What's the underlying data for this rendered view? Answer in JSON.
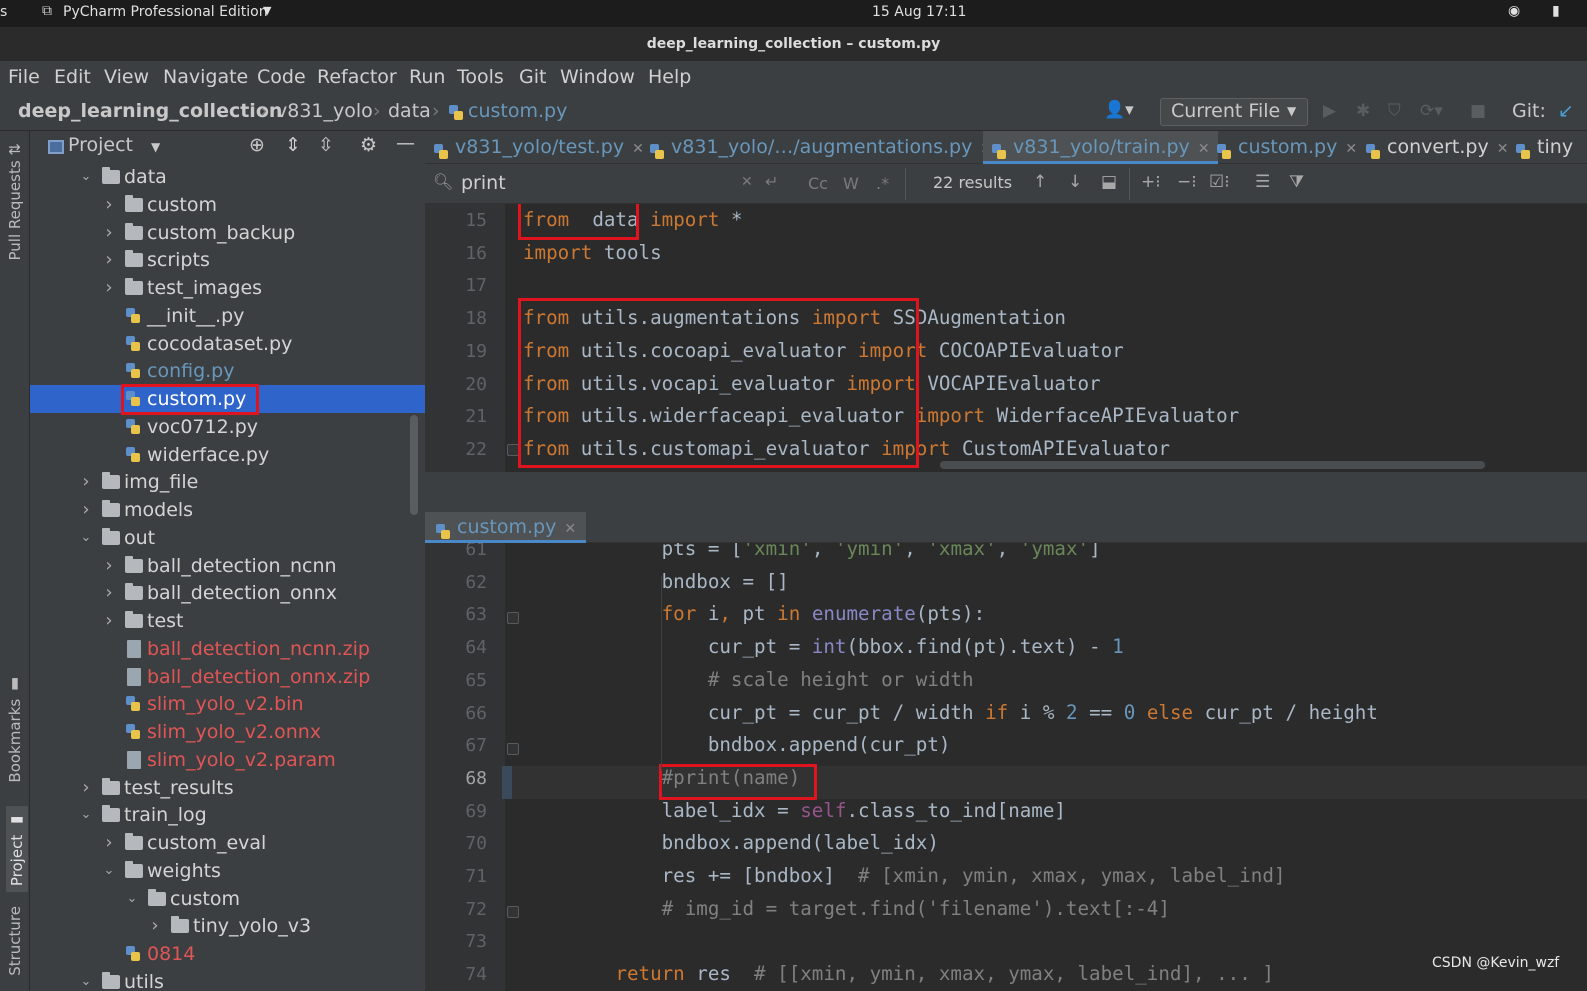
{
  "system_bar": {
    "app_label": "PyCharm Professional Edition",
    "clock": "15 Aug  17:11",
    "left_edge": "s"
  },
  "window_title": "deep_learning_collection – custom.py",
  "menu": [
    "File",
    "Edit",
    "View",
    "Navigate",
    "Code",
    "Refactor",
    "Run",
    "Tools",
    "Git",
    "Window",
    "Help"
  ],
  "breadcrumb": [
    "deep_learning_collection",
    "v831_yolo",
    "data",
    "custom.py"
  ],
  "toolbar": {
    "run_config": "Current File",
    "git_label": "Git:"
  },
  "project_panel": {
    "title": "Project"
  },
  "side_tools": {
    "pull_requests": "Pull Requests",
    "bookmarks": "Bookmarks",
    "project": "Project",
    "structure": "Structure"
  },
  "tree": [
    {
      "label": "data",
      "kind": "folder",
      "depth": 0,
      "expanded": true,
      "color": "normal"
    },
    {
      "label": "custom",
      "kind": "folder",
      "depth": 1,
      "expanded": false,
      "color": "normal"
    },
    {
      "label": "custom_backup",
      "kind": "folder",
      "depth": 1,
      "expanded": false,
      "color": "normal"
    },
    {
      "label": "scripts",
      "kind": "folder",
      "depth": 1,
      "expanded": false,
      "color": "normal"
    },
    {
      "label": "test_images",
      "kind": "folder",
      "depth": 1,
      "expanded": false,
      "color": "normal"
    },
    {
      "label": "__init__.py",
      "kind": "py",
      "depth": 1,
      "color": "normal"
    },
    {
      "label": "cocodataset.py",
      "kind": "py",
      "depth": 1,
      "color": "normal"
    },
    {
      "label": "config.py",
      "kind": "py",
      "depth": 1,
      "color": "blue"
    },
    {
      "label": "custom.py",
      "kind": "py",
      "depth": 1,
      "color": "normal",
      "selected": true
    },
    {
      "label": "voc0712.py",
      "kind": "py",
      "depth": 1,
      "color": "normal"
    },
    {
      "label": "widerface.py",
      "kind": "py",
      "depth": 1,
      "color": "normal"
    },
    {
      "label": "img_file",
      "kind": "folder",
      "depth": 0,
      "expanded": false,
      "color": "normal"
    },
    {
      "label": "models",
      "kind": "folder",
      "depth": 0,
      "expanded": false,
      "color": "normal"
    },
    {
      "label": "out",
      "kind": "folder",
      "depth": 0,
      "expanded": true,
      "color": "normal"
    },
    {
      "label": "ball_detection_ncnn",
      "kind": "folder",
      "depth": 1,
      "expanded": false,
      "color": "normal"
    },
    {
      "label": "ball_detection_onnx",
      "kind": "folder",
      "depth": 1,
      "expanded": false,
      "color": "normal"
    },
    {
      "label": "test",
      "kind": "folder",
      "depth": 1,
      "expanded": false,
      "color": "normal"
    },
    {
      "label": "ball_detection_ncnn.zip",
      "kind": "file",
      "depth": 1,
      "color": "red"
    },
    {
      "label": "ball_detection_onnx.zip",
      "kind": "file",
      "depth": 1,
      "color": "red"
    },
    {
      "label": "slim_yolo_v2.bin",
      "kind": "py",
      "depth": 1,
      "color": "red"
    },
    {
      "label": "slim_yolo_v2.onnx",
      "kind": "py",
      "depth": 1,
      "color": "red"
    },
    {
      "label": "slim_yolo_v2.param",
      "kind": "file",
      "depth": 1,
      "color": "red"
    },
    {
      "label": "test_results",
      "kind": "folder",
      "depth": 0,
      "expanded": false,
      "color": "normal"
    },
    {
      "label": "train_log",
      "kind": "folder",
      "depth": 0,
      "expanded": true,
      "color": "normal"
    },
    {
      "label": "custom_eval",
      "kind": "folder",
      "depth": 1,
      "expanded": false,
      "color": "normal"
    },
    {
      "label": "weights",
      "kind": "folder",
      "depth": 1,
      "expanded": true,
      "color": "normal"
    },
    {
      "label": "custom",
      "kind": "folder",
      "depth": 2,
      "expanded": true,
      "color": "normal"
    },
    {
      "label": "tiny_yolo_v3",
      "kind": "folder",
      "depth": 3,
      "expanded": false,
      "color": "normal"
    },
    {
      "label": "0814",
      "kind": "py",
      "depth": 1,
      "color": "red"
    },
    {
      "label": "utils",
      "kind": "folder",
      "depth": 0,
      "expanded": true,
      "color": "normal"
    }
  ],
  "tabs": [
    {
      "label": "v831_yolo/test.py",
      "closable": true,
      "active": false
    },
    {
      "label": "v831_yolo/…/augmentations.py",
      "closable": true,
      "active": false
    },
    {
      "label": "v831_yolo/train.py",
      "closable": true,
      "active": true
    },
    {
      "label": "custom.py",
      "closable": true,
      "active": false
    },
    {
      "label": "convert.py",
      "closable": true,
      "active": false
    },
    {
      "label": "tiny",
      "closable": false,
      "active": false
    }
  ],
  "search": {
    "query": "print",
    "results": "22 results",
    "opt_case": "Cc",
    "opt_word": "W",
    "opt_regex": ".*"
  },
  "editor_top": {
    "lines": [
      {
        "n": "15",
        "tokens": [
          [
            "kw",
            "from"
          ],
          [
            "",
            "  data "
          ],
          [
            "kw",
            "import"
          ],
          [
            "",
            " *"
          ]
        ]
      },
      {
        "n": "16",
        "tokens": [
          [
            "kw",
            "import"
          ],
          [
            "",
            " tools"
          ]
        ]
      },
      {
        "n": "17",
        "tokens": []
      },
      {
        "n": "18",
        "tokens": [
          [
            "kw",
            "from"
          ],
          [
            "",
            " utils.augmentations "
          ],
          [
            "kw",
            "import"
          ],
          [
            "",
            " SSDAugmentation"
          ]
        ]
      },
      {
        "n": "19",
        "tokens": [
          [
            "kw",
            "from"
          ],
          [
            "",
            " utils.cocoapi_evaluator "
          ],
          [
            "kw",
            "import"
          ],
          [
            "",
            " COCOAPIEvaluator"
          ]
        ]
      },
      {
        "n": "20",
        "tokens": [
          [
            "kw",
            "from"
          ],
          [
            "",
            " utils.vocapi_evaluator "
          ],
          [
            "kw",
            "import"
          ],
          [
            "",
            " VOCAPIEvaluator"
          ]
        ]
      },
      {
        "n": "21",
        "tokens": [
          [
            "kw",
            "from"
          ],
          [
            "",
            " utils.widerfaceapi_evaluator "
          ],
          [
            "kw",
            "import"
          ],
          [
            "",
            " WiderfaceAPIEvaluator"
          ]
        ]
      },
      {
        "n": "22",
        "tokens": [
          [
            "kw",
            "from"
          ],
          [
            "",
            " utils.customapi_evaluator "
          ],
          [
            "kw",
            "import"
          ],
          [
            "",
            " CustomAPIEvaluator"
          ]
        ]
      }
    ]
  },
  "editor_bottom_tab": "custom.py",
  "editor_bottom": {
    "lines": [
      {
        "n": "61",
        "tokens": [
          [
            "",
            "            pts = ["
          ],
          [
            "str",
            "'xmin'"
          ],
          [
            ", "
          ],
          [
            "str",
            "'ymin'"
          ],
          [
            ", "
          ],
          [
            "str",
            "'xmax'"
          ],
          [
            ", "
          ],
          [
            "str",
            "'ymax'"
          ],
          [
            "",
            "]"
          ]
        ]
      },
      {
        "n": "62",
        "tokens": [
          [
            "",
            "            bndbox = []"
          ]
        ]
      },
      {
        "n": "63",
        "tokens": [
          [
            "",
            "            "
          ],
          [
            "kw",
            "for"
          ],
          [
            "",
            " i"
          ],
          [
            "kw",
            ","
          ],
          [
            "",
            " pt "
          ],
          [
            "kw",
            "in"
          ],
          [
            " "
          ],
          [
            "bi",
            "enumerate"
          ],
          [
            "",
            "(pts):"
          ]
        ]
      },
      {
        "n": "64",
        "tokens": [
          [
            "",
            "                cur_pt = "
          ],
          [
            "bi",
            "int"
          ],
          [
            "",
            "(bbox.find(pt).text) - "
          ],
          [
            "num",
            "1"
          ]
        ]
      },
      {
        "n": "65",
        "tokens": [
          [
            "cmt",
            "                # scale height or width"
          ]
        ]
      },
      {
        "n": "66",
        "tokens": [
          [
            "",
            "                cur_pt = cur_pt / width "
          ],
          [
            "kw",
            "if"
          ],
          [
            "",
            " i % "
          ],
          [
            "num",
            "2"
          ],
          [
            "",
            " == "
          ],
          [
            "num",
            "0"
          ],
          [
            " "
          ],
          [
            "kw",
            "else"
          ],
          [
            "",
            " cur_pt / height"
          ]
        ]
      },
      {
        "n": "67",
        "tokens": [
          [
            "",
            "                bndbox.append(cur_pt)"
          ]
        ]
      },
      {
        "n": "68",
        "tokens": [
          [
            "",
            "            "
          ],
          [
            "cmt",
            "#print(name)"
          ]
        ]
      },
      {
        "n": "69",
        "tokens": [
          [
            "",
            "            label_idx = "
          ],
          [
            "slf",
            "self"
          ],
          [
            "",
            ".class_to_ind[name]"
          ]
        ]
      },
      {
        "n": "70",
        "tokens": [
          [
            "",
            "            bndbox.append(label_idx)"
          ]
        ]
      },
      {
        "n": "71",
        "tokens": [
          [
            "",
            "            res += [bndbox]  "
          ],
          [
            "cmt",
            "# [xmin, ymin, xmax, ymax, label_ind]"
          ]
        ]
      },
      {
        "n": "72",
        "tokens": [
          [
            "cmt",
            "            # img_id = target.find('filename').text[:-4]"
          ]
        ]
      },
      {
        "n": "73",
        "tokens": []
      },
      {
        "n": "74",
        "tokens": [
          [
            "",
            "        "
          ],
          [
            "kw",
            "return"
          ],
          [
            "",
            " res  "
          ],
          [
            "cmt",
            "# [[xmin, ymin, xmax, ymax, label_ind], ... ]"
          ]
        ]
      }
    ]
  },
  "watermark": "CSDN @Kevin_wzf"
}
